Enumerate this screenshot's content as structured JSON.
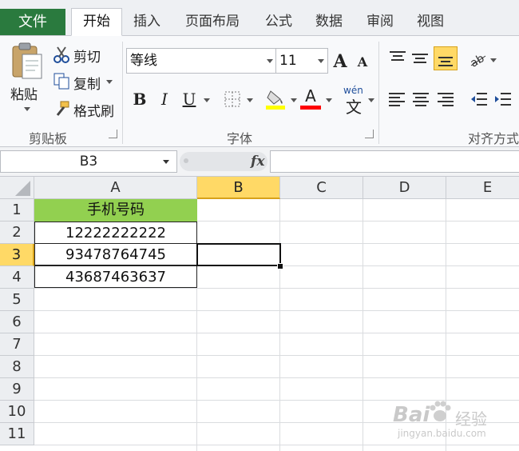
{
  "tabs": {
    "file": "文件",
    "items": [
      "开始",
      "插入",
      "页面布局",
      "公式",
      "数据",
      "审阅",
      "视图"
    ]
  },
  "clipboard": {
    "paste": "粘贴",
    "cut": "剪切",
    "copy": "复制",
    "format_painter": "格式刷",
    "group_label": "剪贴板"
  },
  "font": {
    "name": "等线",
    "size": "11",
    "grow": "A",
    "shrink": "A",
    "bold": "B",
    "italic": "I",
    "underline": "U",
    "font_color_letter": "A",
    "phonetic": "wén",
    "phonetic_char": "文",
    "group_label": "字体",
    "fill_color": "#ffff00",
    "font_color": "#ff0000"
  },
  "alignment": {
    "group_label": "对齐方式"
  },
  "formula_bar": {
    "name_box": "B3",
    "fx": "fx",
    "formula": ""
  },
  "sheet": {
    "columns": [
      "A",
      "B",
      "C",
      "D",
      "E"
    ],
    "selected_column": "B",
    "rows": [
      "1",
      "2",
      "3",
      "4",
      "5",
      "6",
      "7",
      "8",
      "9",
      "10",
      "11"
    ],
    "selected_row": "3",
    "cells": {
      "A1": "手机号码",
      "A2": "12222222222",
      "A3": "93478764745",
      "A4": "43687463637"
    },
    "header_fill": "#92d050"
  },
  "watermark": {
    "brand": "Bai",
    "brand2": "经验",
    "url": "jingyan.baidu.com"
  }
}
